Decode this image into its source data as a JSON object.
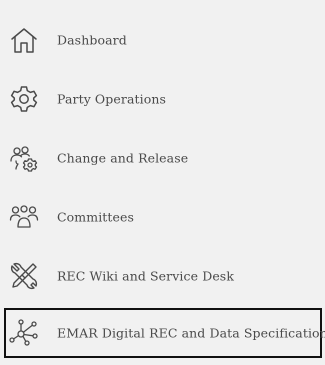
{
  "sidebar": {
    "items": [
      {
        "label": "Dashboard",
        "icon": "home-icon"
      },
      {
        "label": "Party Operations",
        "icon": "gear-icon"
      },
      {
        "label": "Change and Release",
        "icon": "people-gear-icon"
      },
      {
        "label": "Committees",
        "icon": "group-icon"
      },
      {
        "label": "REC Wiki and Service Desk",
        "icon": "tools-icon"
      },
      {
        "label": "EMAR Digital REC and Data Specification",
        "icon": "network-nodes-icon"
      }
    ],
    "active_index": 5
  },
  "colors": {
    "background": "#f1f1f1",
    "icon_stroke": "#4a4a4a",
    "text": "#4a4a4a",
    "active_border": "#111111"
  }
}
